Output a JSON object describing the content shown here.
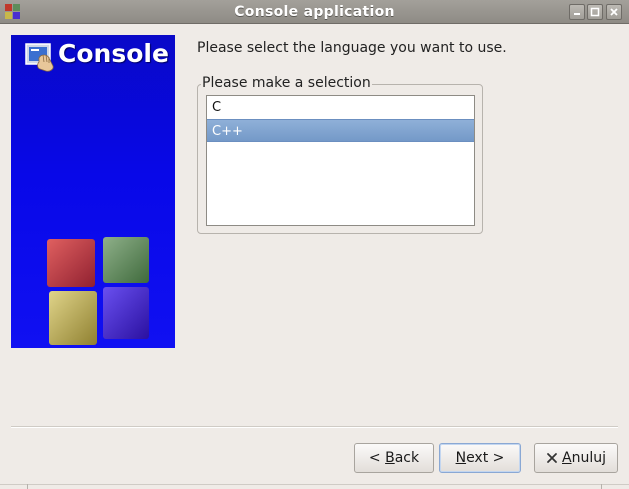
{
  "window": {
    "title": "Console application"
  },
  "banner": {
    "title": "Console",
    "icon": "console-app-icon",
    "cube_colors": [
      "#c0392b",
      "#5e8c5a",
      "#c8b84a",
      "#4a2fd0"
    ]
  },
  "content": {
    "prompt": "Please select the language you want to use.",
    "group_label": "Please make a selection",
    "languages": [
      {
        "label": "C",
        "selected": false
      },
      {
        "label": "C++",
        "selected": true
      }
    ]
  },
  "buttons": {
    "back": {
      "prefix": "< ",
      "underline": "B",
      "rest": "ack"
    },
    "next": {
      "underline": "N",
      "rest": "ext",
      "suffix": " >"
    },
    "cancel": {
      "underline": "A",
      "rest": "nuluj",
      "icon": "cancel-icon"
    }
  },
  "colors": {
    "banner_blue": "#0808e8",
    "selection": "#7499c8",
    "window_bg": "#efebe7"
  }
}
